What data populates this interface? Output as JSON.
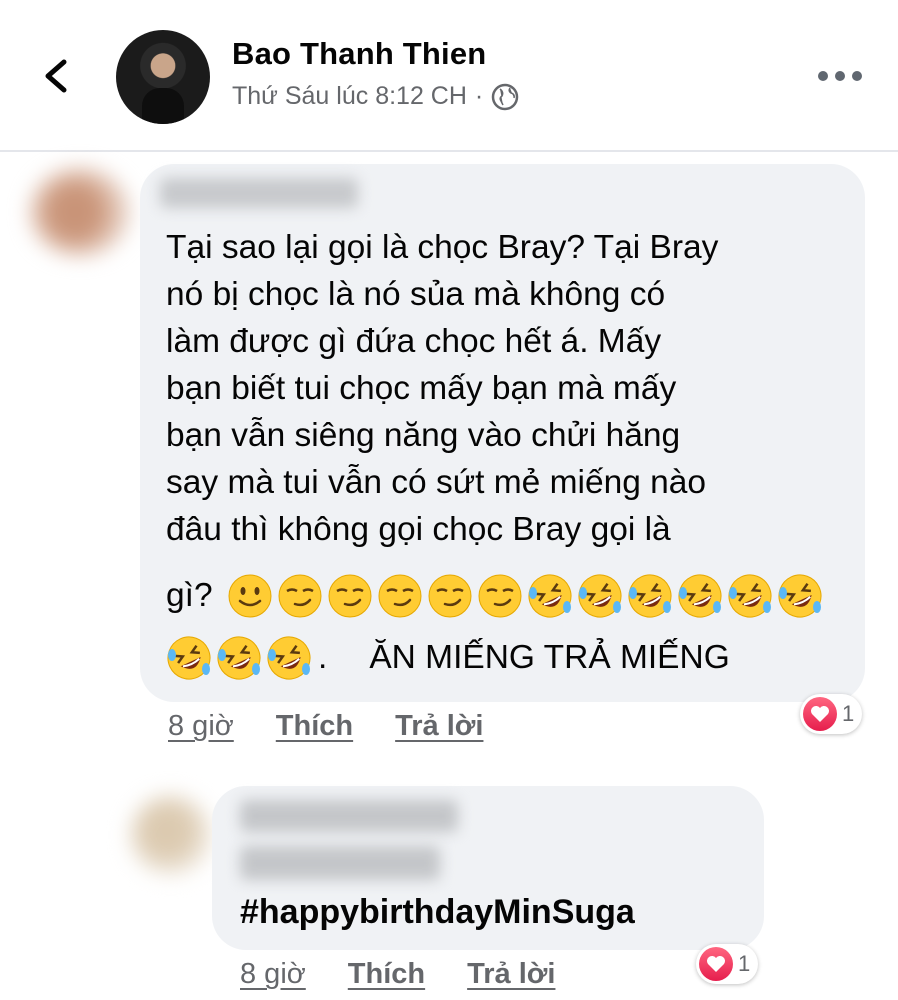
{
  "post": {
    "author": "Bao Thanh Thien",
    "timestamp": "Thứ Sáu lúc 8:12 CH",
    "separator": "·",
    "privacy_icon": "globe-icon",
    "back_icon": "back-chevron-icon",
    "menu_icon": "more-dots-icon"
  },
  "comments": [
    {
      "lines": [
        "Tại sao lại gọi là chọc Bray? Tại Bray",
        "nó bị chọc là nó sủa mà không có",
        "làm được gì đứa chọc hết á. Mấy",
        "bạn biết tui chọc mấy bạn mà mấy",
        "bạn vẫn siêng năng vào chửi hăng",
        "say mà tui vẫn có sứt mẻ miếng nào",
        "đâu thì không gọi chọc Bray gọi là"
      ],
      "line8_prefix": "gì?",
      "line8_emojis": [
        "slightly-smiling-face",
        "smirking-face",
        "smirking-face",
        "smirking-face",
        "smirking-face",
        "smirking-face",
        "rolling-on-floor-laughing",
        "rolling-on-floor-laughing",
        "rolling-on-floor-laughing",
        "rolling-on-floor-laughing",
        "rolling-on-floor-laughing",
        "rolling-on-floor-laughing"
      ],
      "line9_emojis": [
        "rolling-on-floor-laughing",
        "rolling-on-floor-laughing",
        "rolling-on-floor-laughing"
      ],
      "line9_dot": ".",
      "line9_text": "ĂN MIẾNG TRẢ MIẾNG",
      "time": "8 giờ",
      "like_label": "Thích",
      "reply_label": "Trả lời",
      "reaction_count": "1"
    },
    {
      "hashtag": "#happybirthdayMinSuga",
      "time": "8 giờ",
      "like_label": "Thích",
      "reply_label": "Trả lời",
      "reaction_count": "1"
    }
  ],
  "colors": {
    "bubble": "#f0f2f5",
    "secondary_text": "#65676b",
    "heart": "#e61e4d",
    "emoji_yellow": "#ffcc33"
  }
}
